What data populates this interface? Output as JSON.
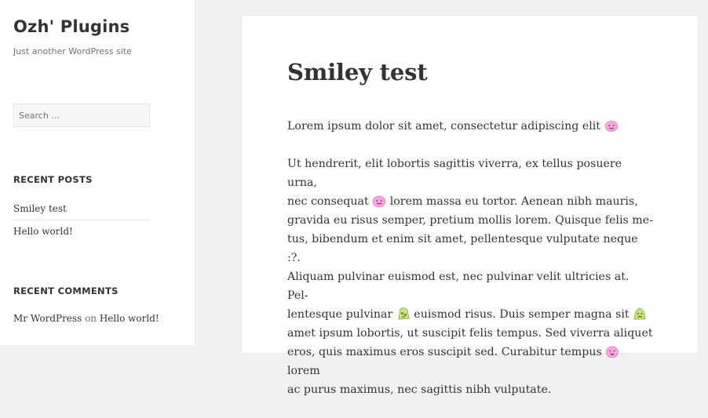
{
  "site": {
    "title": "Ozh' Plugins",
    "description": "Just another WordPress site"
  },
  "search": {
    "placeholder": "Search …"
  },
  "recent_posts": {
    "heading": "RECENT POSTS",
    "items": [
      {
        "label": "Smiley test"
      },
      {
        "label": "Hello world!"
      }
    ]
  },
  "recent_comments": {
    "heading": "RECENT COMMENTS",
    "author": "Mr WordPress",
    "on": "on",
    "post": "Hello world!"
  },
  "article": {
    "title": "Smiley test",
    "p1": {
      "text": "Lorem ipsum dolor sit amet, consectetur adipiscing elit"
    },
    "p2": {
      "lines": [
        "Ut hendrerit, elit lobortis sagittis viverra, ex tellus posuere urna,",
        "nec consequat",
        "lorem massa eu tortor. Aenean nibh mauris,",
        "gravida eu risus semper, pretium mollis lorem. Quisque felis me-",
        "tus, bibendum et enim sit amet, pellentesque vulputate neque :?.",
        "Aliquam pulvinar euismod est, nec pulvinar velit ultricies at. Pel-",
        "lentesque pulvinar",
        "euismod risus. Duis semper magna sit",
        "amet ipsum lobortis, ut suscipit felis tempus. Sed viverra aliquet",
        "eros, quis maximus eros suscipit sed. Curabitur tempus",
        "lorem",
        "ac purus maximus, nec sagittis nibh vulputate."
      ]
    },
    "smileys": {
      "pink": "#f7a8dc",
      "green": "#c8e67a"
    }
  }
}
